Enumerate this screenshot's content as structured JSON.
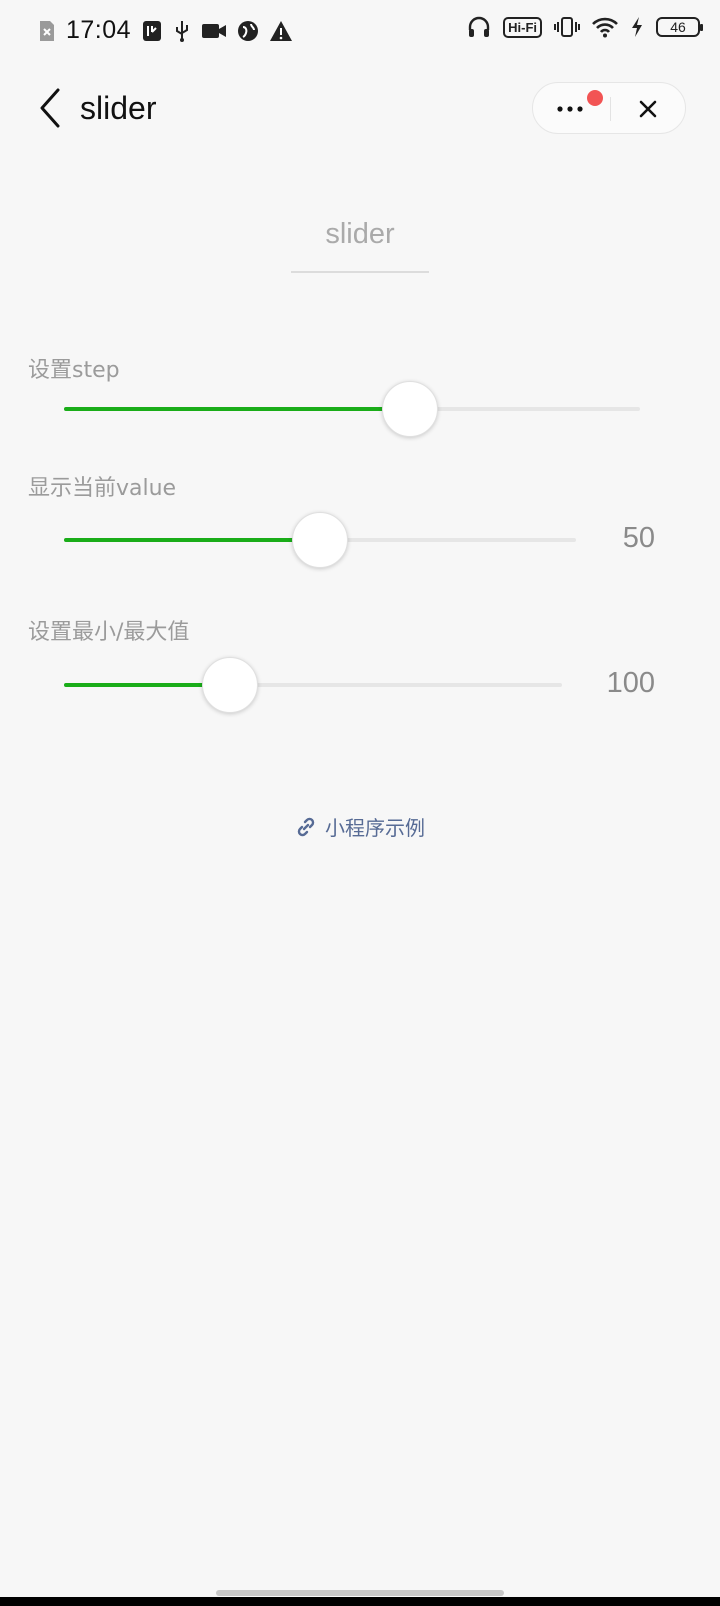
{
  "status_bar": {
    "time": "17:04",
    "hifi": "Hi-Fi",
    "battery": "46",
    "icons": [
      "sim-off-icon",
      "usb-debug-icon",
      "usb-icon",
      "video-icon",
      "vpn-icon",
      "warning-icon",
      "headphones-icon",
      "vibrate-icon",
      "wifi-icon",
      "charging-icon"
    ]
  },
  "nav": {
    "title": "slider",
    "back_icon": "chevron-left-icon",
    "more_icon": "more-dots-icon",
    "close_icon": "close-icon",
    "badge_color": "#f25454"
  },
  "page": {
    "title": "slider"
  },
  "sections": [
    {
      "label": "设置step",
      "min": 0,
      "max": 100,
      "value": 60,
      "show_value": false
    },
    {
      "label": "显示当前value",
      "min": 0,
      "max": 100,
      "value": 50,
      "show_value": true,
      "value_text": "50"
    },
    {
      "label": "设置最小/最大值",
      "min": 50,
      "max": 200,
      "value": 100,
      "show_value": true,
      "value_text": "100"
    }
  ],
  "footer": {
    "icon": "link-icon",
    "text": "小程序示例"
  },
  "colors": {
    "accent": "#1aad19",
    "link": "#576b95"
  }
}
